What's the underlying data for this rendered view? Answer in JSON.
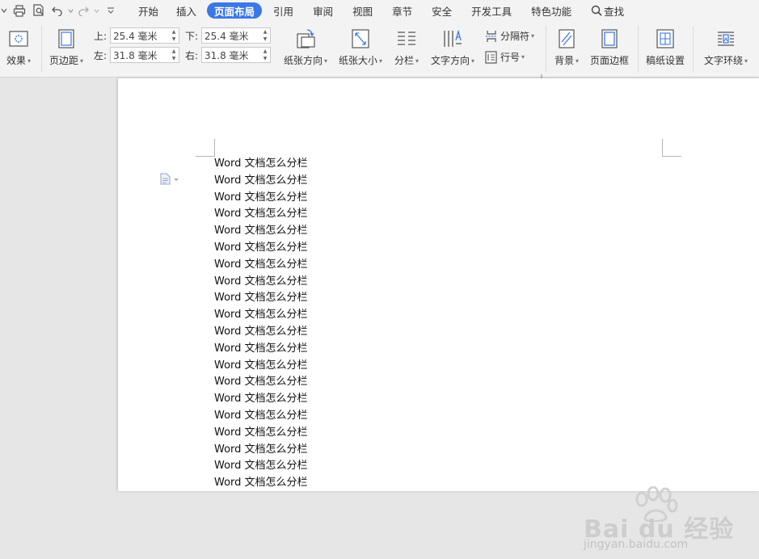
{
  "menubar": {
    "tabs": [
      {
        "label": "开始"
      },
      {
        "label": "插入"
      },
      {
        "label": "页面布局",
        "active": true
      },
      {
        "label": "引用"
      },
      {
        "label": "审阅"
      },
      {
        "label": "视图"
      },
      {
        "label": "章节"
      },
      {
        "label": "安全"
      },
      {
        "label": "开发工具"
      },
      {
        "label": "特色功能"
      }
    ],
    "search_label": "查找"
  },
  "ribbon": {
    "effects_label": "效果",
    "margins_label": "页边距",
    "margin_top_label": "上:",
    "margin_top_value": "25.4 毫米",
    "margin_bottom_label": "下:",
    "margin_bottom_value": "25.4 毫米",
    "margin_left_label": "左:",
    "margin_left_value": "31.8 毫米",
    "margin_right_label": "右:",
    "margin_right_value": "31.8 毫米",
    "orientation_label": "纸张方向",
    "paper_size_label": "纸张大小",
    "columns_label": "分栏",
    "text_direction_label": "文字方向",
    "breaks_label": "分隔符",
    "line_numbers_label": "行号",
    "background_label": "背景",
    "page_border_label": "页面边框",
    "manuscript_label": "稿纸设置",
    "text_wrap_label": "文字环绕"
  },
  "document": {
    "lines": [
      "Word 文档怎么分栏",
      "Word 文档怎么分栏",
      "Word 文档怎么分栏",
      "Word 文档怎么分栏",
      "Word 文档怎么分栏",
      "Word 文档怎么分栏",
      "Word 文档怎么分栏",
      "Word 文档怎么分栏",
      "Word 文档怎么分栏",
      "Word 文档怎么分栏",
      "Word 文档怎么分栏",
      "Word 文档怎么分栏",
      "Word 文档怎么分栏",
      "Word 文档怎么分栏",
      "Word 文档怎么分栏",
      "Word 文档怎么分栏",
      "Word 文档怎么分栏",
      "Word 文档怎么分栏",
      "Word 文档怎么分栏",
      "Word 文档怎么分栏"
    ]
  },
  "watermark": {
    "brand": "Bai du 经验",
    "url": "jingyan.baidu.com"
  },
  "colors": {
    "accent": "#3b78e7",
    "ribbon_bg": "#f3f3f3",
    "workspace_bg": "#e6e6e6"
  }
}
